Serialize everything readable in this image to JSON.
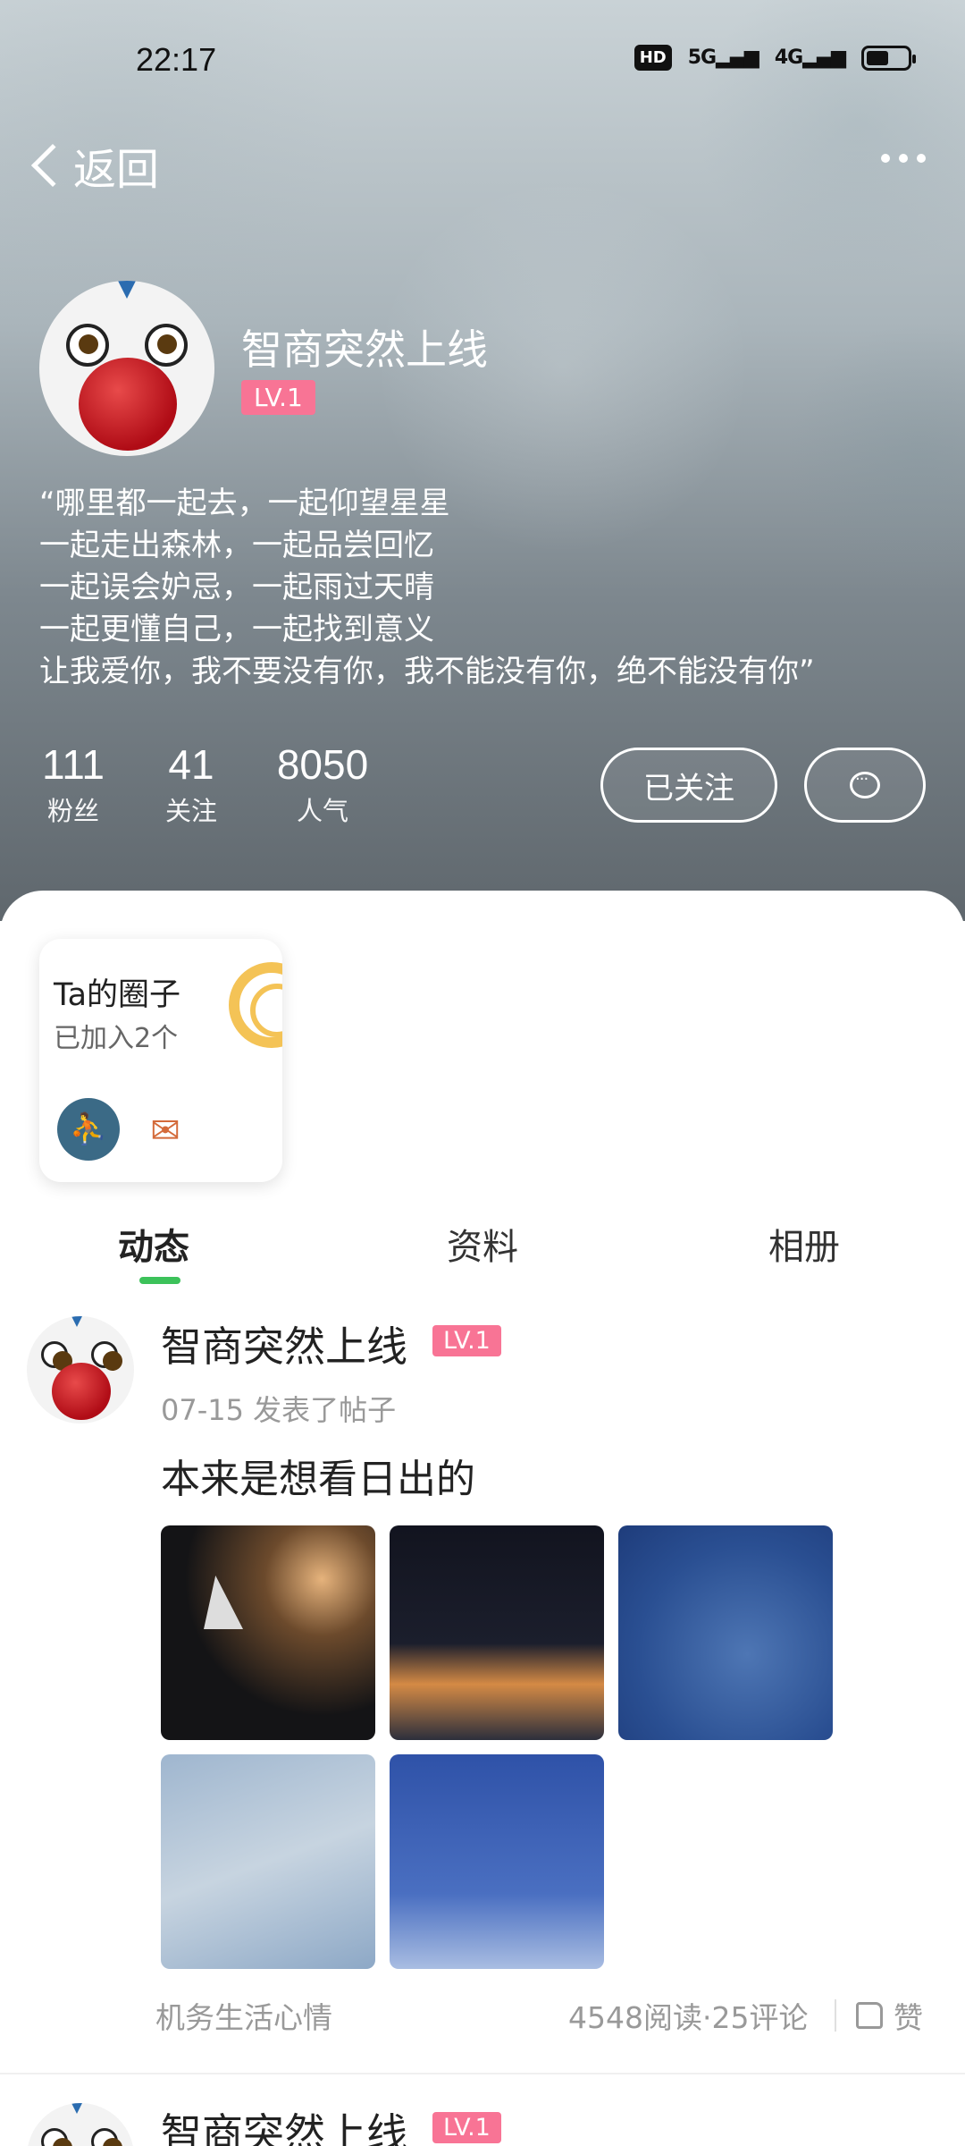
{
  "status_bar": {
    "time": "22:17",
    "hd_badge": "HD",
    "signal_5g": "5G",
    "signal_4g": "4G",
    "battery_level": 0.55
  },
  "nav": {
    "back_label": "返回"
  },
  "profile": {
    "username": "智商突然上线",
    "level": "LV.1",
    "bio": [
      "“哪里都一起去，一起仰望星星",
      "一起走出森林，一起品尝回忆",
      "一起误会妒忌，一起雨过天晴",
      "一起更懂自己，一起找到意义",
      "让我爱你，我不要没有你，我不能没有你，绝不能没有你”"
    ],
    "stats": [
      {
        "value": "111",
        "label": "粉丝"
      },
      {
        "value": "41",
        "label": "关注"
      },
      {
        "value": "8050",
        "label": "人气"
      }
    ],
    "follow_button": "已关注"
  },
  "circles": {
    "title": "Ta的圈子",
    "subtitle": "已加入2个"
  },
  "tabs": [
    {
      "label": "动态",
      "active": true
    },
    {
      "label": "资料",
      "active": false
    },
    {
      "label": "相册",
      "active": false
    }
  ],
  "posts": [
    {
      "author": "智商突然上线",
      "level": "LV.1",
      "meta": "07-15 发表了帖子",
      "text": "本来是想看日出的",
      "photo_count": 5,
      "tag": "机务生活心情",
      "stats": "4548阅读·25评论",
      "like_label": "赞"
    },
    {
      "author": "智商突然上线",
      "level": "LV.1"
    }
  ],
  "colors": {
    "accent_green": "#3cc25a",
    "level_pink": "#f87495",
    "ring_yellow": "#f4c356"
  }
}
